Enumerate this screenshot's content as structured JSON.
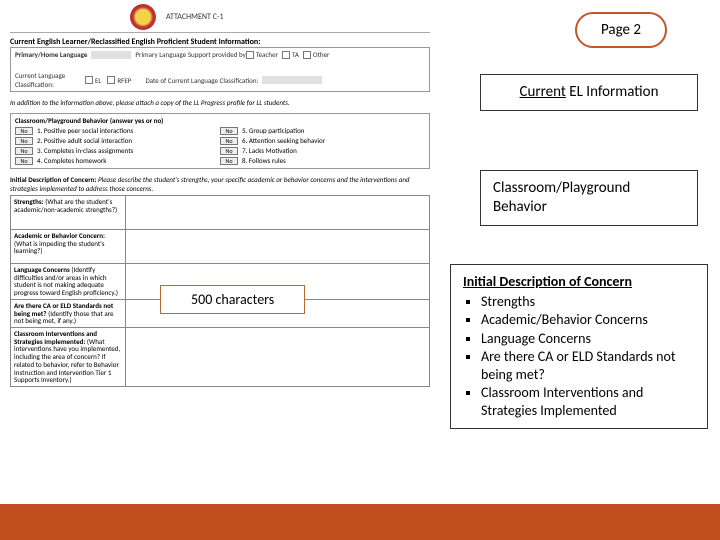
{
  "header": {
    "attachment": "ATTACHMENT C-1",
    "section_title": "Current English Learner/Reclassified English Proficient Student Information:"
  },
  "el_block": {
    "primary_label": "Primary/Home Language",
    "support_label": "Primary Language Support provided by",
    "opt_teacher": "Teacher",
    "opt_ta": "TA",
    "opt_other": "Other",
    "class_label": "Current Language Classification:",
    "opt_el": "EL",
    "opt_rfep": "RFEP",
    "date_label": "Date of Current Language Classification:",
    "attach_note": "In addition to the information above, please attach a copy of the LL Progress profile for LL students."
  },
  "behavior_block": {
    "title": "Classroom/Playground Behavior (answer yes or no)",
    "no": "No",
    "items_left": [
      "1. Positive peer social interactions",
      "2. Positive adult social interaction",
      "3. Completes in-class assignments",
      "4. Completes homework"
    ],
    "items_right": [
      "5. Group participation",
      "6. Attention seeking behavior",
      "7. Lacks Motivation",
      "8. Follows rules"
    ]
  },
  "concern_block": {
    "intro_bold": "Initial Description of Concern:",
    "intro_rest": " Please describe the student's strengths, your specific academic or behavior concerns and the interventions and strategies implemented to address those concerns.",
    "rows": [
      {
        "bold": "Strengths:",
        "sub": " (What are the student's academic/non-academic strengths?)"
      },
      {
        "bold": "Academic or Behavior Concern:",
        "sub": " (What is impeding the student's learning?)"
      },
      {
        "bold": "Language Concerns",
        "sub": " (Identify difficulties and/or areas in which student is not making adequate progress toward English proficiency.)"
      },
      {
        "bold": "Are there CA or ELD Standards not being met?",
        "sub": " (Identify those that are not being met, if any.)"
      },
      {
        "bold": "Classroom Interventions and Strategies Implemented:",
        "sub": " (What interventions have you implemented, including the area of concern? If related to behavior, refer to Behavior Instruction and Intervention Tier 1 Supports Inventory.)"
      }
    ]
  },
  "char_box": "500 characters",
  "page_pill": "Page 2",
  "annot_el_prefix": "Current",
  "annot_el_rest": " EL Information",
  "annot_behav": "Classroom/Playground Behavior",
  "annot_concern": {
    "title": "Initial Description of Concern",
    "bullets": [
      "Strengths",
      "Academic/Behavior Concerns",
      "Language Concerns",
      "Are there CA or ELD Standards not being met?",
      "Classroom Interventions and Strategies Implemented"
    ]
  }
}
